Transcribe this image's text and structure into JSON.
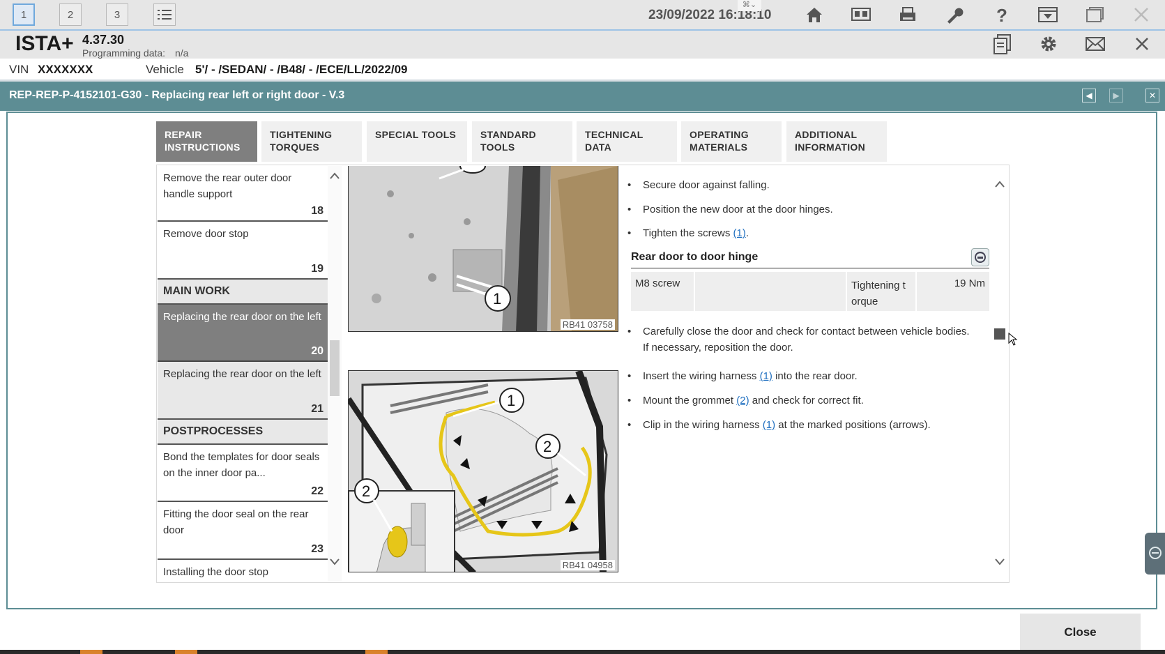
{
  "toolbar": {
    "tabs": [
      "1",
      "2",
      "3"
    ],
    "datetime": "23/09/2022 16:18:10",
    "icons": [
      "home-icon",
      "split-view-icon",
      "printer-icon",
      "wrench-icon",
      "help-icon",
      "download-icon",
      "window-icon",
      "close-icon"
    ]
  },
  "header": {
    "brand": "ISTA+",
    "version": "4.37.30",
    "programming_label": "Programming data:",
    "programming_value": "n/a",
    "vin_label": "VIN",
    "vin_value": "XXXXXXX",
    "vehicle_label": "Vehicle",
    "vehicle_value": "5'/ - /SEDAN/ - /B48/ - /ECE/LL/2022/09"
  },
  "title": "REP-REP-P-4152101-G30 - Replacing rear left or right door - V.3",
  "tabs": [
    {
      "line1": "REPAIR",
      "line2": "INSTRUCTIONS"
    },
    {
      "line1": "TIGHTENING",
      "line2": "TORQUES"
    },
    {
      "line1": "SPECIAL TOOLS",
      "line2": ""
    },
    {
      "line1": "STANDARD",
      "line2": "TOOLS"
    },
    {
      "line1": "TECHNICAL",
      "line2": "DATA"
    },
    {
      "line1": "OPERATING",
      "line2": "MATERIALS"
    },
    {
      "line1": "ADDITIONAL",
      "line2": "INFORMATION"
    }
  ],
  "nav": {
    "items": [
      {
        "label": "Remove the rear outer door handle support",
        "num": "18"
      },
      {
        "label": "Remove door stop",
        "num": "19"
      },
      {
        "label": "Replacing the rear door on the left",
        "num": "20"
      },
      {
        "label": "Replacing the rear door on the left",
        "num": "21"
      },
      {
        "label": "Bond the templates for door seals on the inner door pa...",
        "num": "22"
      },
      {
        "label": "Fitting the door seal on the rear door",
        "num": "23"
      },
      {
        "label": "Installing the door stop",
        "num": ""
      }
    ],
    "sections": {
      "main": "MAIN WORK",
      "post": "POSTPROCESSES"
    }
  },
  "images": {
    "top_ref": "RB41 03758",
    "bottom_ref": "RB41 04958",
    "callouts": [
      "1",
      "1",
      "2",
      "2"
    ]
  },
  "content": {
    "b1": "Secure door against falling.",
    "b2": "Position the new door at the door hinges.",
    "b3_pre": "Tighten the screws ",
    "b3_link": "(1)",
    "b3_post": ".",
    "torque_heading": "Rear door to door hinge",
    "torque": {
      "part": "M8 screw",
      "type": "Tightening t orque",
      "value": "19 Nm"
    },
    "b4": "Carefully close the door and check for contact between vehicle bodies. If necessary, reposition the door.",
    "b5_pre": "Insert the wiring harness ",
    "b5_link": "(1)",
    "b5_post": " into the rear door.",
    "b6_pre": "Mount the grommet ",
    "b6_link": "(2)",
    "b6_post": " and check for correct fit.",
    "b7_pre": "Clip in the wiring harness ",
    "b7_link": "(1)",
    "b7_post": " at the marked positions (arrows)."
  },
  "close_label": "Close",
  "colors": {
    "title_bar": "#5d8d94",
    "selected": "#7f7f7f",
    "link": "#1f6fc0",
    "harness": "#e6c619"
  }
}
